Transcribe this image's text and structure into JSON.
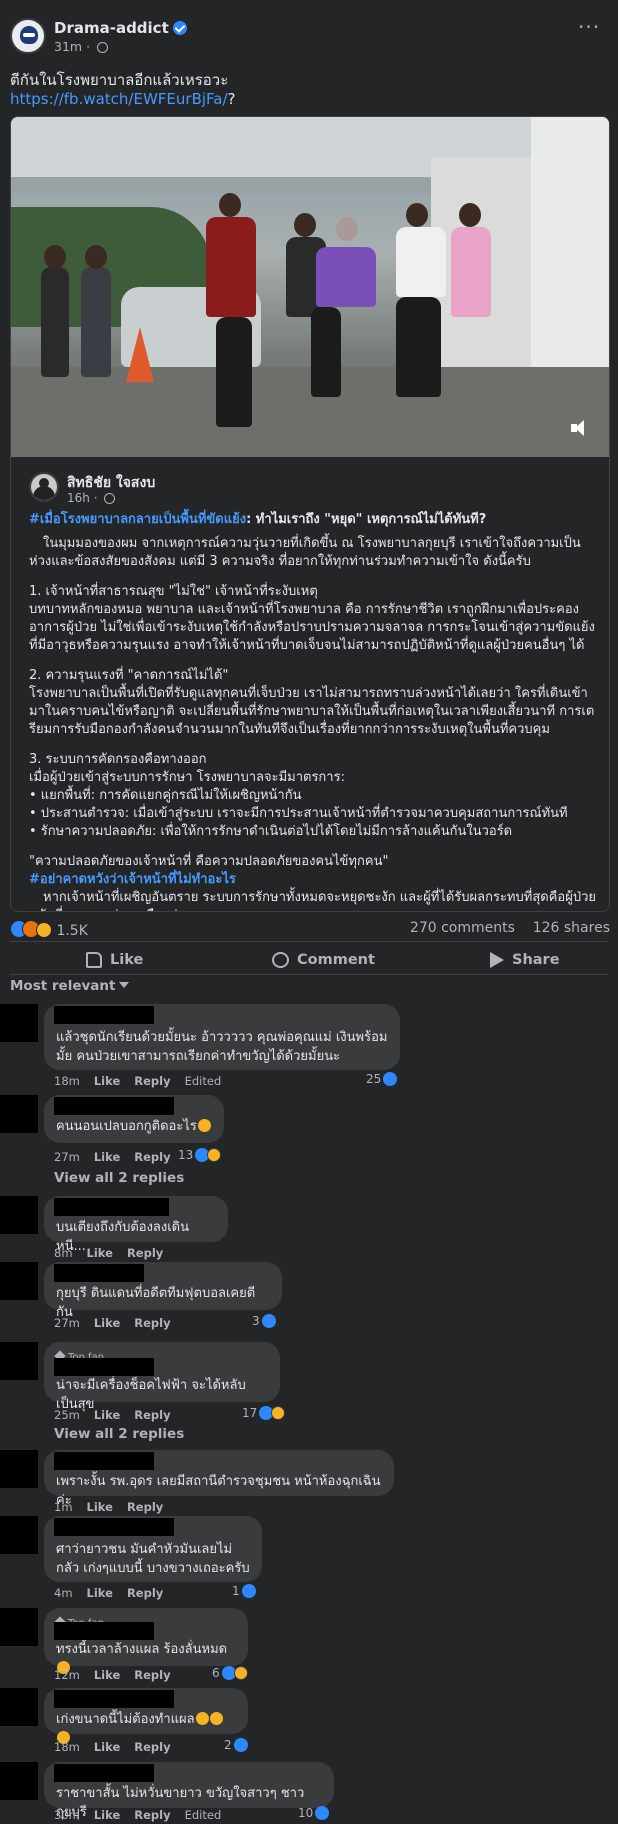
{
  "post": {
    "page_name": "Drama-addict",
    "time": "31m",
    "text": "ตีกันในโรงพยาบาลอีกแล้วเหรอวะ",
    "link": "https://fb.watch/EWFEurBjFa/",
    "link_suffix": "?"
  },
  "shared": {
    "author_name": "สิทธิชัย ใจสงบ",
    "author_time": "16h",
    "headline_hashtag": "#เมื่อโรงพยาบาลกลายเป็นพื้นที่ขัดแย้ง",
    "headline_rest": ": ทำไมเราถึง \"หยุด\" เหตุการณ์ไม่ได้ทันที?",
    "intro": "ในมุมมองของผม จากเหตุการณ์ความวุ่นวายที่เกิดขึ้น ณ โรงพยาบาลกุยบุรี เราเข้าใจถึงความเป็นห่วงและข้อสงสัยของสังคม แต่มี 3 ความจริง ที่อยากให้ทุกท่านร่วมทำความเข้าใจ ดังนี้ครับ",
    "point1_title": "1. เจ้าหน้าที่สาธารณสุข \"ไม่ใช่\" เจ้าหน้าที่ระงับเหตุ",
    "point1_body": "บทบาทหลักของหมอ พยาบาล และเจ้าหน้าที่โรงพยาบาล คือ การรักษาชีวิต เราถูกฝึกมาเพื่อประคองอาการผู้ป่วย ไม่ใช่เพื่อเข้าระงับเหตุใช้กำลังหรือปราบปรามความจลาจล การกระโจนเข้าสู่ความขัดแย้งที่มีอาวุธหรือความรุนแรง อาจทำให้เจ้าหน้าที่บาดเจ็บจนไม่สามารถปฏิบัติหน้าที่ดูแลผู้ป่วยคนอื่นๆ ได้",
    "point2_title": "2. ความรุนแรงที่ \"คาดการณ์ไม่ได้\"",
    "point2_body": "โรงพยาบาลเป็นพื้นที่เปิดที่รับดูแลทุกคนที่เจ็บป่วย เราไม่สามารถทราบล่วงหน้าได้เลยว่า ใครที่เดินเข้ามาในคราบคนไข้หรือญาติ จะเปลี่ยนพื้นที่รักษาพยาบาลให้เป็นพื้นที่ก่อเหตุในเวลาเพียงเสี้ยวนาที การเตรียมการรับมือกองกำลังคนจำนวนมากในทันทีจึงเป็นเรื่องที่ยากกว่าการระงับเหตุในพื้นที่ควบคุม",
    "point3_title": "3. ระบบการคัดกรองคือทางออก",
    "point3_intro": "เมื่อผู้ป่วยเข้าสู่ระบบการรักษา โรงพยาบาลจะมีมาตรการ:",
    "bullets": [
      "• แยกพื้นที่: การคัดแยกคู่กรณีไม่ให้เผชิญหน้ากัน",
      "• ประสานตำรวจ: เมื่อเข้าสู่ระบบ เราจะมีการประสานเจ้าหน้าที่ตำรวจมาควบคุมสถานการณ์ทันที",
      "• รักษาความปลอดภัย: เพื่อให้การรักษาดำเนินต่อไปได้โดยไม่มีการล้างแค้นกันในวอร์ด"
    ],
    "quote": "\"ความปลอดภัยของเจ้าหน้าที่ คือความปลอดภัยของคนไข้ทุกคน\"",
    "hashtag2": "#อย่าคาดหวังว่าเจ้าหน้าที่ไม่ทำอะไร",
    "closing": "หากเจ้าหน้าที่เผชิญอันตราย ระบบการรักษาทั้งหมดจะหยุดชะงัก และผู้ที่ได้รับผลกระทบที่สุดคือผู้ป่วยหนักที่รอความช่วยเหลืออยู่"
  },
  "stats": {
    "reactions": "1.5K",
    "comments": "270 comments",
    "shares": "126 shares"
  },
  "actions": {
    "like": "Like",
    "comment": "Comment",
    "share": "Share"
  },
  "sort": "Most relevant",
  "comment_labels": {
    "like": "Like",
    "reply": "Reply",
    "edited": "Edited",
    "top_fan": "Top fan"
  },
  "comments": [
    {
      "text": "แล้วชุดนักเรียนด้วยมั้ยนะ อ้าววววว คุณพ่อคุณแม่ เงินพร้อมมั้ย คนป่วยเขาสามารถเรียกค่าทำขวัญได้ด้วยมั้ยนะ",
      "time": "18m",
      "count": "25"
    },
    {
      "text": "คนนอนเปลบอกกูติดอะไร",
      "time": "27m",
      "count": "13"
    },
    {
      "text": "บนเตียงถึงกับต้องลงเดินหนี...",
      "time": "8m",
      "count": ""
    },
    {
      "text": "กุยบุรี ดินแดนที่อดีตทีมฟุตบอลเคยตีกัน",
      "time": "27m",
      "count": "3"
    },
    {
      "text": "น่าจะมีเครื่องช็อคไฟฟ้า จะได้หลับเป็นสุข",
      "time": "25m",
      "count": "17"
    },
    {
      "text": "เพราะงั้น รพ.อุดร เลยมีสถานีตำรวจชุมชน หน้าห้องฉุกเฉินค่ะ",
      "time": "1m",
      "count": ""
    },
    {
      "text": "ศาว่ายาวชน มันคำหัวมันเลยไม่กลัว เก่งๆแบบนี้ บางขวางเถอะครับ",
      "time": "4m",
      "count": "1"
    },
    {
      "text": "ทรงนี้เวลาล้างแผล ร้องลั่นหมด",
      "time": "12m",
      "count": "6"
    },
    {
      "text": "เก่งขนาดนี้ไม่ต้องทำแผล",
      "time": "18m",
      "count": "2"
    },
    {
      "text": "ราชาขาสั้น ไม่หวั่นขายาว ขวัญใจสาวๆ ชาวกุยบุรี",
      "time": "30m",
      "count": "10"
    }
  ],
  "view_all": [
    "View all 2 replies",
    "View all 2 replies"
  ],
  "colors": {
    "background": "#242526",
    "bubble": "#3a3b3c",
    "link": "#4599ff",
    "like_blue": "#2d88ff"
  }
}
